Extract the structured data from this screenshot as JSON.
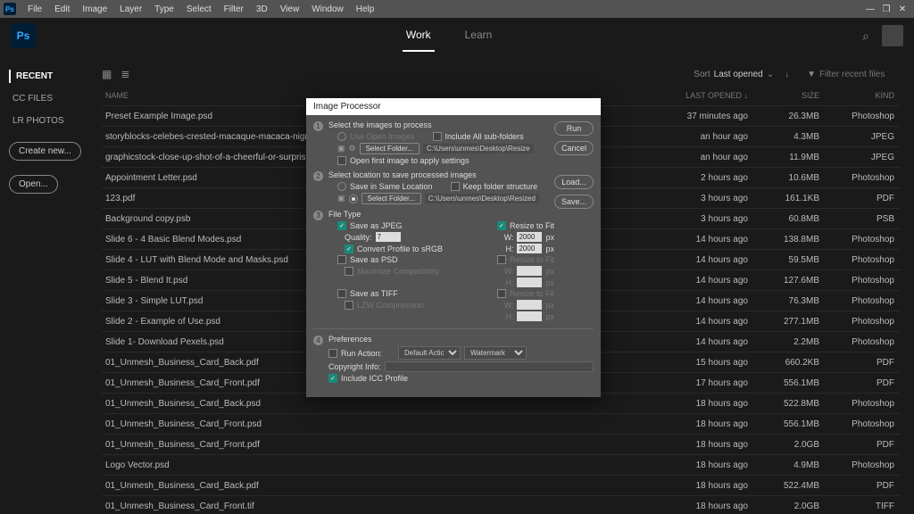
{
  "app": {
    "code": "Ps"
  },
  "menubar": [
    "File",
    "Edit",
    "Image",
    "Layer",
    "Type",
    "Select",
    "Filter",
    "3D",
    "View",
    "Window",
    "Help"
  ],
  "window_controls": {
    "min": "—",
    "max": "❐",
    "close": "✕"
  },
  "header": {
    "tabs": {
      "work": "Work",
      "learn": "Learn"
    },
    "search_glyph": "⌕"
  },
  "sidebar": {
    "recent": "RECENT",
    "ccfiles": "CC FILES",
    "lrphotos": "LR PHOTOS",
    "create": "Create new...",
    "open": "Open..."
  },
  "toolbar": {
    "sort_label": "Sort",
    "sort_value": "Last opened",
    "chev": "⌄",
    "arrow": "↓",
    "filter_glyph": "▼",
    "filter_placeholder": "Filter recent files",
    "grid_glyph": "▦",
    "list_glyph": "≣"
  },
  "columns": {
    "name": "NAME",
    "last": "LAST OPENED ↓",
    "size": "SIZE",
    "kind": "KIND"
  },
  "files": [
    {
      "name": "Preset Example Image.psd",
      "last": "37 minutes ago",
      "size": "26.3MB",
      "kind": "Photoshop"
    },
    {
      "name": "storyblocks-celebes-crested-macaque-macaca-nigra-black-monkey-detail-portrait.jpg",
      "last": "an hour ago",
      "size": "4.3MB",
      "kind": "JPEG"
    },
    {
      "name": "graphicstock-close-up-shot-of-a-cheerful-or-surprised-girl-wearing.jpg",
      "last": "an hour ago",
      "size": "11.9MB",
      "kind": "JPEG"
    },
    {
      "name": "Appointment Letter.psd",
      "last": "2 hours ago",
      "size": "10.6MB",
      "kind": "Photoshop"
    },
    {
      "name": "123.pdf",
      "last": "3 hours ago",
      "size": "161.1KB",
      "kind": "PDF"
    },
    {
      "name": "Background copy.psb",
      "last": "3 hours ago",
      "size": "60.8MB",
      "kind": "PSB"
    },
    {
      "name": "Slide 6 - 4 Basic Blend Modes.psd",
      "last": "14 hours ago",
      "size": "138.8MB",
      "kind": "Photoshop"
    },
    {
      "name": "Slide 4 - LUT with Blend Mode and Masks.psd",
      "last": "14 hours ago",
      "size": "59.5MB",
      "kind": "Photoshop"
    },
    {
      "name": "Slide 5 - Blend It.psd",
      "last": "14 hours ago",
      "size": "127.6MB",
      "kind": "Photoshop"
    },
    {
      "name": "Slide 3 - Simple LUT.psd",
      "last": "14 hours ago",
      "size": "76.3MB",
      "kind": "Photoshop"
    },
    {
      "name": "Slide 2 - Example of Use.psd",
      "last": "14 hours ago",
      "size": "277.1MB",
      "kind": "Photoshop"
    },
    {
      "name": "Slide 1- Download Pexels.psd",
      "last": "14 hours ago",
      "size": "2.2MB",
      "kind": "Photoshop"
    },
    {
      "name": "01_Unmesh_Business_Card_Back.pdf",
      "last": "15 hours ago",
      "size": "660.2KB",
      "kind": "PDF"
    },
    {
      "name": "01_Unmesh_Business_Card_Front.pdf",
      "last": "17 hours ago",
      "size": "556.1MB",
      "kind": "PDF"
    },
    {
      "name": "01_Unmesh_Business_Card_Back.psd",
      "last": "18 hours ago",
      "size": "522.8MB",
      "kind": "Photoshop"
    },
    {
      "name": "01_Unmesh_Business_Card_Front.psd",
      "last": "18 hours ago",
      "size": "556.1MB",
      "kind": "Photoshop"
    },
    {
      "name": "01_Unmesh_Business_Card_Front.pdf",
      "last": "18 hours ago",
      "size": "2.0GB",
      "kind": "PDF"
    },
    {
      "name": "Logo Vector.psd",
      "last": "18 hours ago",
      "size": "4.9MB",
      "kind": "Photoshop"
    },
    {
      "name": "01_Unmesh_Business_Card_Back.pdf",
      "last": "18 hours ago",
      "size": "522.4MB",
      "kind": "PDF"
    },
    {
      "name": "01_Unmesh_Business_Card_Front.tif",
      "last": "18 hours ago",
      "size": "2.0GB",
      "kind": "TIFF"
    }
  ],
  "dialog": {
    "title": "Image Processor",
    "side": {
      "run": "Run",
      "cancel": "Cancel",
      "load": "Load...",
      "save": "Save..."
    },
    "s1": {
      "title": "Select the images to process",
      "use_open": "Use Open Images",
      "include_sub": "Include All sub-folders",
      "select_folder": "Select Folder...",
      "path": "C:\\Users\\unmes\\Desktop\\Resize",
      "open_first": "Open first image to apply settings"
    },
    "s2": {
      "title": "Select location to save processed images",
      "same_loc": "Save in Same Location",
      "keep_struct": "Keep folder structure",
      "select_folder": "Select Folder...",
      "path": "C:\\Users\\unmes\\Desktop\\Resized"
    },
    "s3": {
      "title": "File Type",
      "save_jpeg": "Save as JPEG",
      "quality_lbl": "Quality:",
      "quality_val": "7",
      "convert_srgb": "Convert Profile to sRGB",
      "resize_fit": "Resize to Fit",
      "w_lbl": "W:",
      "h_lbl": "H:",
      "px": "px",
      "w_val": "2000",
      "h_val": "2000",
      "save_psd": "Save as PSD",
      "max_compat": "Maximize Compatibility",
      "save_tiff": "Save as TIFF",
      "lzw": "LZW Compression"
    },
    "s4": {
      "title": "Preferences",
      "run_action": "Run Action:",
      "action_set": "Default Actions",
      "action": "Watermark",
      "copyright": "Copyright Info:",
      "icc": "Include ICC Profile"
    }
  }
}
